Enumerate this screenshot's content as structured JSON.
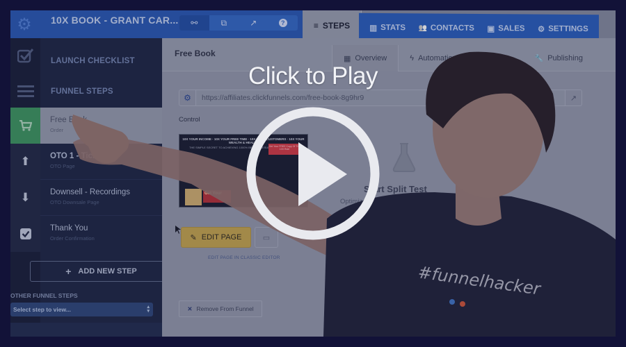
{
  "overlay": {
    "cta_text": "Click to Play",
    "play_icon": "play-circle-icon"
  },
  "colors": {
    "page_background": "#121238",
    "app_blue": "#2a59b0",
    "active_step_green": "#3c8c5c",
    "edit_button_gold": "#b79a4c",
    "sidebar_dark": "#1f2742"
  },
  "topbar": {
    "funnel_title": "10X BOOK - GRANT CAR...",
    "tools": [
      {
        "icon": "link-icon",
        "glyph": "⚯"
      },
      {
        "icon": "clone-icon",
        "glyph": "⧉"
      },
      {
        "icon": "external-link-icon",
        "glyph": "↗"
      },
      {
        "icon": "help-icon",
        "glyph": "?"
      }
    ]
  },
  "nav": {
    "steps": {
      "label": "STEPS",
      "icon": "list-icon"
    },
    "tabs": [
      {
        "label": "STATS",
        "icon": "bar-chart-icon",
        "glyph": "▥"
      },
      {
        "label": "CONTACTS",
        "icon": "users-icon",
        "glyph": "👥"
      },
      {
        "label": "SALES",
        "icon": "money-icon",
        "glyph": "▣"
      },
      {
        "label": "SETTINGS",
        "icon": "gear-icon",
        "glyph": "⚙"
      }
    ]
  },
  "sidebar": {
    "launch_checklist": "LAUNCH CHECKLIST",
    "funnel_steps": "FUNNEL STEPS",
    "steps": [
      {
        "title": "Free Book",
        "subtitle": "Order",
        "icon": "cart-icon",
        "glyph": "🛒",
        "active": true
      },
      {
        "title": "OTO 1 - Tickets",
        "subtitle": "OTO Page",
        "icon": "arrow-up-icon",
        "glyph": "⬆",
        "active": false
      },
      {
        "title": "Downsell - Recordings",
        "subtitle": "OTO Downsale Page",
        "icon": "arrow-down-icon",
        "glyph": "⬇",
        "active": false
      },
      {
        "title": "Thank You",
        "subtitle": "Order Confirmation",
        "icon": "check-square-icon",
        "glyph": "☑",
        "active": false
      }
    ],
    "add_new_step": "ADD NEW STEP",
    "other_funnel_steps": "OTHER FUNNEL STEPS",
    "select_placeholder": "Select step to view..."
  },
  "main": {
    "title": "Free Book",
    "subtabs": [
      {
        "label": "Overview",
        "icon": "grid-icon",
        "glyph": "▦"
      },
      {
        "label": "Automation",
        "icon": "bolt-icon",
        "glyph": "ϟ"
      },
      {
        "label": "Publishing",
        "icon": "wrench-icon",
        "glyph": "🔧"
      }
    ],
    "url": "https://affiliates.clickfunnels.com/free-book-8g9hr9",
    "control_label": "Control",
    "thumbnail": {
      "headline": "10X YOUR INCOME · 10X YOUR FREE TIME · 10X YOUR CUSTOMERS · 10X YOUR WEALTH & HEALTH",
      "subline": "THE SIMPLE SECRET TO ACHIEVING 1000% BETTER RESULTS",
      "cta": "Get Your FREE Copy Of The 10X Rule",
      "promo": "Get Your"
    },
    "edit_page": "EDIT PAGE",
    "edit_classic": "EDIT PAGE IN CLASSIC EDITOR",
    "remove_from_funnel": "Remove From Funnel",
    "split_test": {
      "title": "Start Split Test",
      "subtitle": "Optimize your lead and sales"
    }
  },
  "presenter": {
    "shirt_text": "#funnelhacker"
  }
}
